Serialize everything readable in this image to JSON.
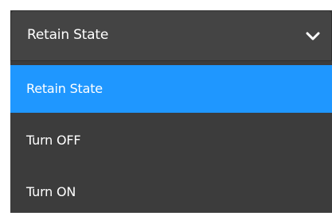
{
  "dropdown": {
    "selected_value": "Retain State",
    "chevron_icon": "chevron-down-icon",
    "options": [
      {
        "label": "Retain State",
        "selected": true
      },
      {
        "label": "Turn OFF",
        "selected": false
      },
      {
        "label": "Turn ON",
        "selected": false
      }
    ]
  },
  "colors": {
    "header_bg": "#444444",
    "menu_bg": "#3c3c3c",
    "selected_bg": "#1f97ff",
    "text": "#ffffff"
  }
}
